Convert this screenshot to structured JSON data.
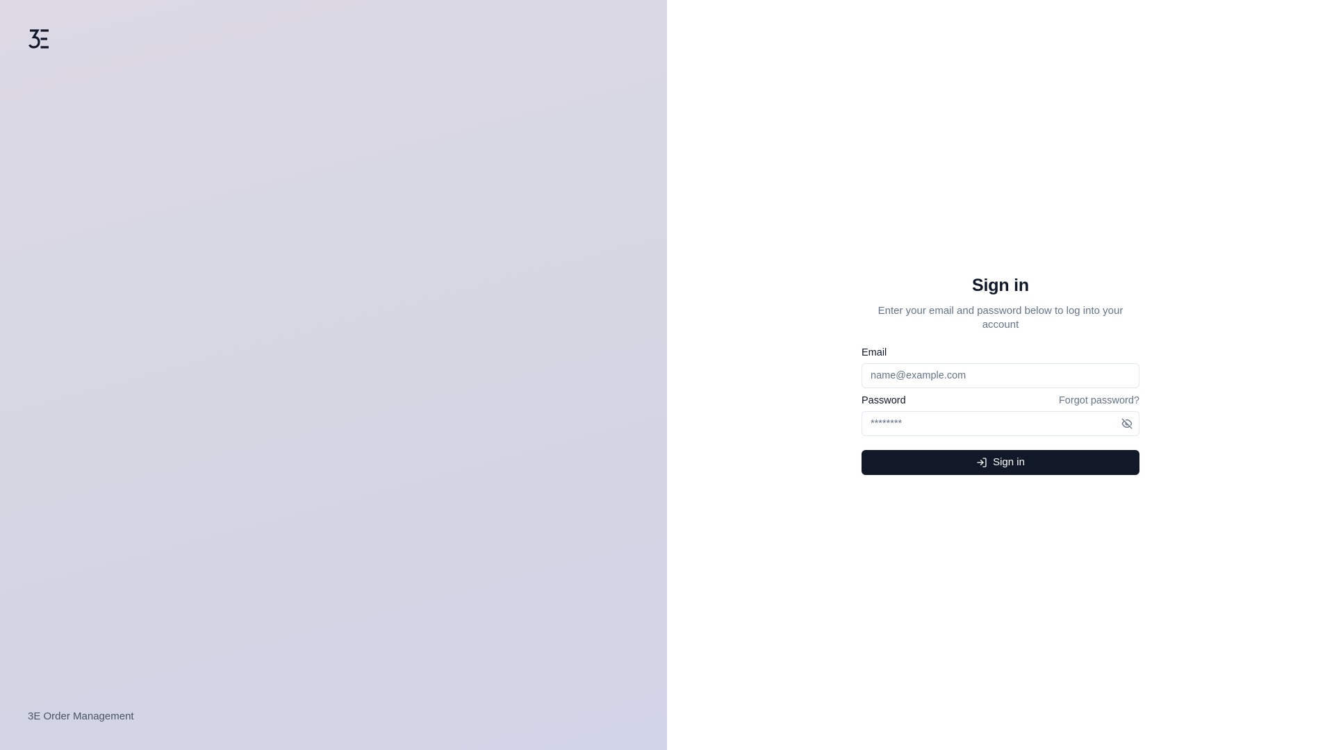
{
  "brand": {
    "logo_icon": "3e-logo-icon",
    "footer_text": "3E Order Management"
  },
  "signin": {
    "title": "Sign in",
    "subtitle": "Enter your email and password below to log into your account",
    "email": {
      "label": "Email",
      "value": "",
      "placeholder": "name@example.com"
    },
    "password": {
      "label": "Password",
      "value": "",
      "placeholder": "********",
      "forgot_link": "Forgot password?",
      "toggle_icon": "eye-off-icon"
    },
    "submit": {
      "label": "Sign in",
      "icon": "log-in-icon"
    }
  },
  "colors": {
    "brand_panel_bg": "#d8d7e4",
    "primary_button": "#111827",
    "muted_text": "#64748b",
    "input_border": "#e2e8f0"
  }
}
